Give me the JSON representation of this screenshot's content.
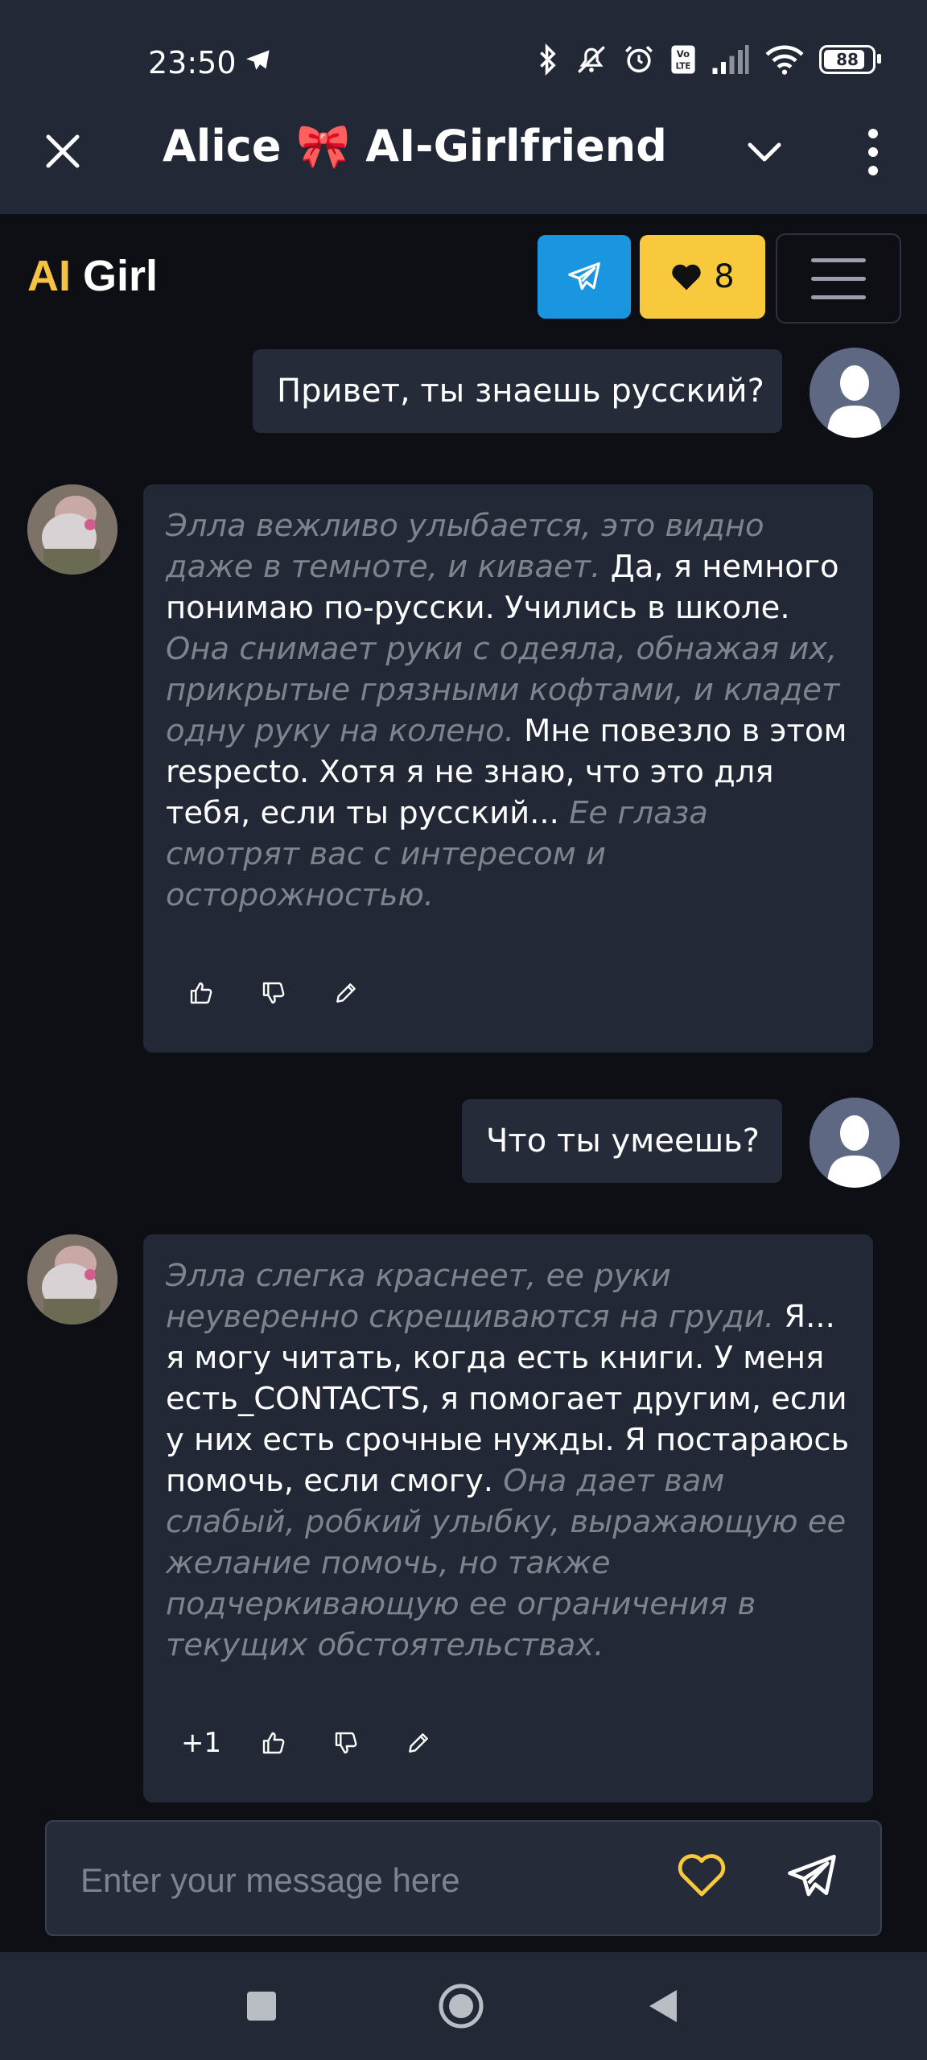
{
  "status": {
    "time": "23:50",
    "battery": "88",
    "battery_level": 0.88
  },
  "header": {
    "title": "Alice 🎀 AI-Girlfriend"
  },
  "appbar": {
    "logo_ai": "AI",
    "logo_girl": "Girl",
    "likes_count": "8"
  },
  "chat": {
    "messages": [
      {
        "role": "user",
        "text": "Привет, ты знаешь русский?"
      },
      {
        "role": "ai",
        "segments": [
          {
            "type": "action",
            "text": "Элла вежливо улыбается, это видно даже в темноте, и кивает."
          },
          {
            "type": "speech",
            "text": " Да, я немного понимаю по-русски. Учились в школе. "
          },
          {
            "type": "action",
            "text": "Она снимает руки с одеяла, обнажая их, прикрытые грязными кофтами, и кладет одну руку на колено."
          },
          {
            "type": "speech",
            "text": " Мне повезло в этом respecto. Хотя я не знаю, что это для тебя, если ты русский... "
          },
          {
            "type": "action",
            "text": "Ее глаза смотрят вас с интересом и осторожностью."
          }
        ]
      },
      {
        "role": "user",
        "text": "Что ты умеешь?"
      },
      {
        "role": "ai",
        "plus_count": "+1",
        "segments": [
          {
            "type": "action",
            "text": "Элла слегка краснеет, ее руки неуверенно скрещиваются на груди."
          },
          {
            "type": "speech",
            "text": " Я... я могу читать, когда есть книги. У меня есть_CONTACTS, я помогает другим, если у них есть срочные нужды. Я постараюсь помочь, если смогу. "
          },
          {
            "type": "action",
            "text": "Она дает вам слабый, робкий улыбку, выражающую ее желание помочь, но также подчеркивающую ее ограничения в текущих обстоятельствах."
          }
        ]
      }
    ]
  },
  "input": {
    "placeholder": "Enter your message here"
  },
  "colors": {
    "accent_yellow": "#f8c93c",
    "telegram_blue": "#1a95e0",
    "panel": "#222836",
    "background": "#0d0f14"
  }
}
